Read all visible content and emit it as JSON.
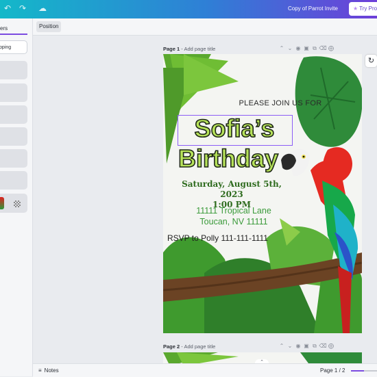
{
  "topbar": {
    "undo_icon": "undo-icon",
    "redo_icon": "redo-icon",
    "cloud_icon": "cloud-saved-icon",
    "doc_title": "Copy of Parrot Invite",
    "try_label": "Try Pro",
    "try_icon": "crown-icon"
  },
  "left_panel": {
    "tab_label": "ers",
    "grouping_button": "pping",
    "layer_count": 7
  },
  "context": {
    "position_label": "Position"
  },
  "pages": [
    {
      "label": "Page 1",
      "separator": " - ",
      "title_placeholder": "Add page title"
    },
    {
      "label": "Page 2",
      "separator": " - ",
      "title_placeholder": "Add page title"
    }
  ],
  "page_tools": [
    "chevron-up-icon",
    "chevron-down-icon",
    "hide-icon",
    "lock-icon",
    "duplicate-icon",
    "delete-icon",
    "add-page-icon"
  ],
  "refresh_icon": "refresh-icon",
  "invite": {
    "join": "PLEASE JOIN US FOR",
    "name": "Sofia’s",
    "birthday": "Birthday",
    "date_line1": "Saturday, August 5th, 2023",
    "date_line2": "1:00 PM",
    "address_line1": "11111 Tropical Lane",
    "address_line2": "Toucan, NV 11111",
    "rsvp": "RSVP to Polly 111-111-1111"
  },
  "bottom": {
    "notes_label": "Notes",
    "notes_icon": "notes-icon",
    "page_indicator": "Page 1 / 2",
    "progress": 0.5,
    "collapse_icon": "chevron-up-icon"
  },
  "colors": {
    "accent": "#7b4be0",
    "title_fill": "#b6e25a",
    "date_green": "#2e6b1e",
    "address_green": "#3a9a3a"
  }
}
